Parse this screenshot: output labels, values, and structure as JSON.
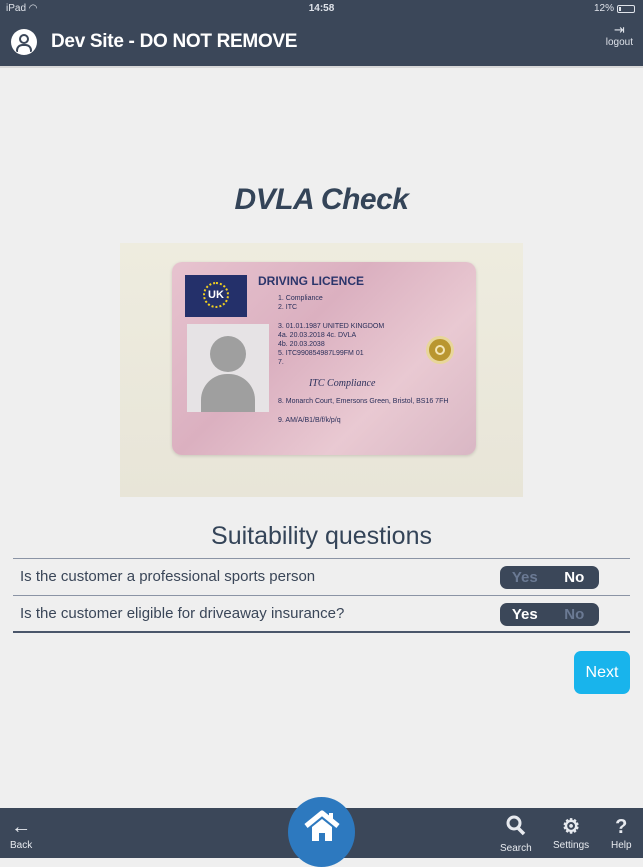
{
  "status_bar": {
    "device": "iPad",
    "time": "14:58",
    "battery": "12%"
  },
  "header": {
    "title": "Dev Site - DO NOT REMOVE",
    "logout_label": "logout"
  },
  "page": {
    "title": "DVLA Check"
  },
  "licence": {
    "heading": "DRIVING LICENCE",
    "country": "UK",
    "fields": [
      "1.  Compliance",
      "2.  ITC",
      "3.  01.01.1987   UNITED KINGDOM",
      "4a. 20.03.2018   4c.  DVLA",
      "4b. 20.03.2038",
      "5.  ITC990854987L99FM   01",
      "7."
    ],
    "signature": "ITC Compliance",
    "address": "8.  Monarch Court, Emersons Green, Bristol, BS16 7FH",
    "categories": "9.  AM/A/B1/B/f/k/p/q"
  },
  "suitability": {
    "title": "Suitability questions",
    "questions": [
      {
        "text": "Is the customer a professional sports person",
        "yes": "Yes",
        "no": "No",
        "selected": "No"
      },
      {
        "text": "Is the customer eligible for driveaway insurance?",
        "yes": "Yes",
        "no": "No",
        "selected": "Yes"
      }
    ]
  },
  "next_label": "Next",
  "footer": {
    "back": "Back",
    "search": "Search",
    "settings": "Settings",
    "help": "Help"
  },
  "icons": {
    "back": "←",
    "search": "⚲",
    "settings": "⚙",
    "help": "?",
    "logout": "⇥"
  }
}
